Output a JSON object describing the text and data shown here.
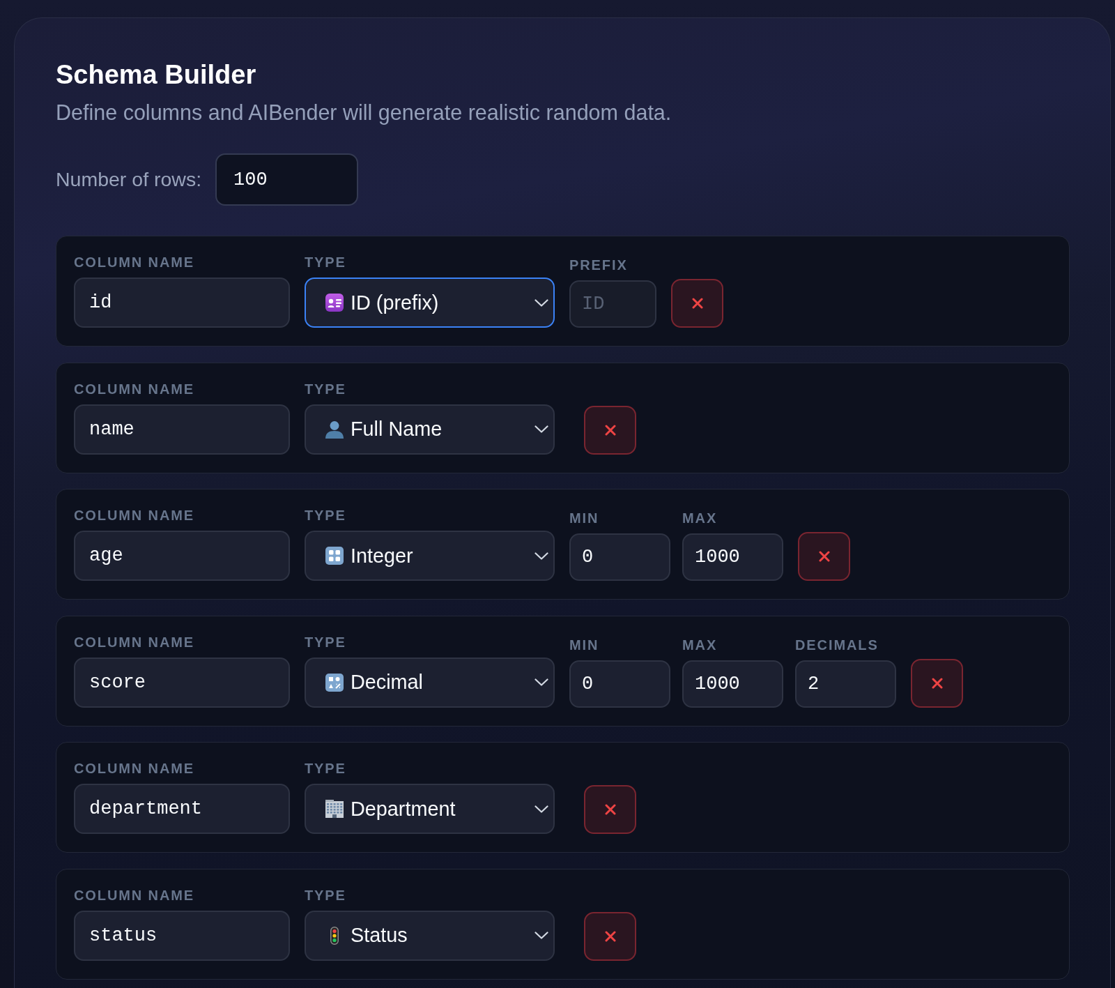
{
  "title": "Schema Builder",
  "subtitle": "Define columns and AIBender will generate realistic random data.",
  "row_count": {
    "label": "Number of rows:",
    "value": "100"
  },
  "columns": [
    {
      "kind": "id",
      "name_field": {
        "label": "COLUMN NAME",
        "value": "id"
      },
      "type_field": {
        "label": "TYPE",
        "value": "ID (prefix)",
        "focused": true
      },
      "options": [
        {
          "kind": "text",
          "label": "PREFIX",
          "placeholder": "ID"
        }
      ]
    },
    {
      "kind": "person",
      "name_field": {
        "label": "COLUMN NAME",
        "value": "name"
      },
      "type_field": {
        "label": "TYPE",
        "value": "Full Name",
        "focused": false
      }
    },
    {
      "kind": "integer",
      "name_field": {
        "label": "COLUMN NAME",
        "value": "age"
      },
      "type_field": {
        "label": "TYPE",
        "value": "Integer",
        "focused": false
      },
      "options": [
        {
          "kind": "number",
          "label": "MIN",
          "value": "0"
        },
        {
          "kind": "number",
          "label": "MAX",
          "value": "1000"
        }
      ]
    },
    {
      "kind": "decimal",
      "name_field": {
        "label": "COLUMN NAME",
        "value": "score"
      },
      "type_field": {
        "label": "TYPE",
        "value": "Decimal",
        "focused": false
      },
      "options": [
        {
          "kind": "number",
          "label": "MIN",
          "value": "0"
        },
        {
          "kind": "number",
          "label": "MAX",
          "value": "1000"
        },
        {
          "kind": "number",
          "label": "DECIMALS",
          "value": "2"
        }
      ]
    },
    {
      "kind": "department",
      "name_field": {
        "label": "COLUMN NAME",
        "value": "department"
      },
      "type_field": {
        "label": "TYPE",
        "value": "Department",
        "focused": false
      }
    },
    {
      "kind": "status",
      "name_field": {
        "label": "COLUMN NAME",
        "value": "status"
      },
      "type_field": {
        "label": "TYPE",
        "value": "Status",
        "focused": false
      }
    }
  ]
}
